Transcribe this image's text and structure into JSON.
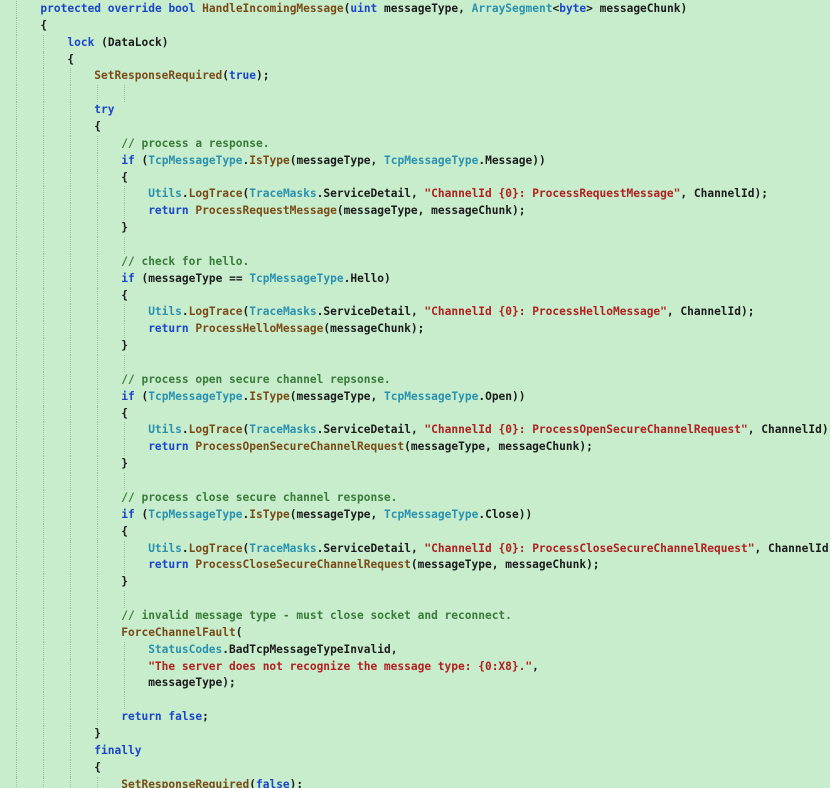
{
  "editor": {
    "background": "#c7edcc",
    "colors": {
      "keyword": "#1b46c9",
      "type": "#2b91af",
      "string": "#b12020",
      "comment": "#3a7a3a",
      "method": "#7a4a16",
      "text": "#1b1b1b"
    },
    "lines": [
      [
        [
          "ws",
          "      "
        ],
        [
          "kw",
          "protected"
        ],
        [
          "ws",
          " "
        ],
        [
          "kw",
          "override"
        ],
        [
          "ws",
          " "
        ],
        [
          "kw",
          "bool"
        ],
        [
          "ws",
          " "
        ],
        [
          "mth",
          "HandleIncomingMessage"
        ],
        [
          "punc",
          "("
        ],
        [
          "kw",
          "uint"
        ],
        [
          "ws",
          " "
        ],
        [
          "ident",
          "messageType"
        ],
        [
          "punc",
          ", "
        ],
        [
          "cls",
          "ArraySegment"
        ],
        [
          "punc",
          "<"
        ],
        [
          "kw",
          "byte"
        ],
        [
          "punc",
          "> "
        ],
        [
          "ident",
          "messageChunk"
        ],
        [
          "punc",
          ")"
        ]
      ],
      [
        [
          "ws",
          "      "
        ],
        [
          "punc",
          "{"
        ]
      ],
      [
        [
          "ws",
          "          "
        ],
        [
          "kw",
          "lock"
        ],
        [
          "ws",
          " "
        ],
        [
          "punc",
          "("
        ],
        [
          "ident",
          "DataLock"
        ],
        [
          "punc",
          ")"
        ]
      ],
      [
        [
          "ws",
          "          "
        ],
        [
          "punc",
          "{"
        ]
      ],
      [
        [
          "ws",
          "              "
        ],
        [
          "mth",
          "SetResponseRequired"
        ],
        [
          "punc",
          "("
        ],
        [
          "kw",
          "true"
        ],
        [
          "punc",
          ");"
        ]
      ],
      [],
      [
        [
          "ws",
          "              "
        ],
        [
          "kw",
          "try"
        ]
      ],
      [
        [
          "ws",
          "              "
        ],
        [
          "punc",
          "{"
        ]
      ],
      [
        [
          "ws",
          "                  "
        ],
        [
          "cmt",
          "// process a response."
        ]
      ],
      [
        [
          "ws",
          "                  "
        ],
        [
          "kw",
          "if"
        ],
        [
          "ws",
          " "
        ],
        [
          "punc",
          "("
        ],
        [
          "cls",
          "TcpMessageType"
        ],
        [
          "punc",
          "."
        ],
        [
          "mth",
          "IsType"
        ],
        [
          "punc",
          "("
        ],
        [
          "ident",
          "messageType"
        ],
        [
          "punc",
          ", "
        ],
        [
          "cls",
          "TcpMessageType"
        ],
        [
          "punc",
          "."
        ],
        [
          "prop",
          "Message"
        ],
        [
          "punc",
          "))"
        ]
      ],
      [
        [
          "ws",
          "                  "
        ],
        [
          "punc",
          "{"
        ]
      ],
      [
        [
          "ws",
          "                      "
        ],
        [
          "cls",
          "Utils"
        ],
        [
          "punc",
          "."
        ],
        [
          "mth",
          "LogTrace"
        ],
        [
          "punc",
          "("
        ],
        [
          "cls",
          "TraceMasks"
        ],
        [
          "punc",
          "."
        ],
        [
          "prop",
          "ServiceDetail"
        ],
        [
          "punc",
          ", "
        ],
        [
          "str",
          "\"ChannelId {0}: ProcessRequestMessage\""
        ],
        [
          "punc",
          ", "
        ],
        [
          "ident",
          "ChannelId"
        ],
        [
          "punc",
          ");"
        ]
      ],
      [
        [
          "ws",
          "                      "
        ],
        [
          "kw",
          "return"
        ],
        [
          "ws",
          " "
        ],
        [
          "mth",
          "ProcessRequestMessage"
        ],
        [
          "punc",
          "("
        ],
        [
          "ident",
          "messageType"
        ],
        [
          "punc",
          ", "
        ],
        [
          "ident",
          "messageChunk"
        ],
        [
          "punc",
          ");"
        ]
      ],
      [
        [
          "ws",
          "                  "
        ],
        [
          "punc",
          "}"
        ]
      ],
      [],
      [
        [
          "ws",
          "                  "
        ],
        [
          "cmt",
          "// check for hello."
        ]
      ],
      [
        [
          "ws",
          "                  "
        ],
        [
          "kw",
          "if"
        ],
        [
          "ws",
          " "
        ],
        [
          "punc",
          "("
        ],
        [
          "ident",
          "messageType"
        ],
        [
          "ws",
          " "
        ],
        [
          "punc",
          "=="
        ],
        [
          "ws",
          " "
        ],
        [
          "cls",
          "TcpMessageType"
        ],
        [
          "punc",
          "."
        ],
        [
          "prop",
          "Hello"
        ],
        [
          "punc",
          ")"
        ]
      ],
      [
        [
          "ws",
          "                  "
        ],
        [
          "punc",
          "{"
        ]
      ],
      [
        [
          "ws",
          "                      "
        ],
        [
          "cls",
          "Utils"
        ],
        [
          "punc",
          "."
        ],
        [
          "mth",
          "LogTrace"
        ],
        [
          "punc",
          "("
        ],
        [
          "cls",
          "TraceMasks"
        ],
        [
          "punc",
          "."
        ],
        [
          "prop",
          "ServiceDetail"
        ],
        [
          "punc",
          ", "
        ],
        [
          "str",
          "\"ChannelId {0}: ProcessHelloMessage\""
        ],
        [
          "punc",
          ", "
        ],
        [
          "ident",
          "ChannelId"
        ],
        [
          "punc",
          ");"
        ]
      ],
      [
        [
          "ws",
          "                      "
        ],
        [
          "kw",
          "return"
        ],
        [
          "ws",
          " "
        ],
        [
          "mth",
          "ProcessHelloMessage"
        ],
        [
          "punc",
          "("
        ],
        [
          "ident",
          "messageChunk"
        ],
        [
          "punc",
          ");"
        ]
      ],
      [
        [
          "ws",
          "                  "
        ],
        [
          "punc",
          "}"
        ]
      ],
      [],
      [
        [
          "ws",
          "                  "
        ],
        [
          "cmt",
          "// process open secure channel repsonse."
        ]
      ],
      [
        [
          "ws",
          "                  "
        ],
        [
          "kw",
          "if"
        ],
        [
          "ws",
          " "
        ],
        [
          "punc",
          "("
        ],
        [
          "cls",
          "TcpMessageType"
        ],
        [
          "punc",
          "."
        ],
        [
          "mth",
          "IsType"
        ],
        [
          "punc",
          "("
        ],
        [
          "ident",
          "messageType"
        ],
        [
          "punc",
          ", "
        ],
        [
          "cls",
          "TcpMessageType"
        ],
        [
          "punc",
          "."
        ],
        [
          "prop",
          "Open"
        ],
        [
          "punc",
          "))"
        ]
      ],
      [
        [
          "ws",
          "                  "
        ],
        [
          "punc",
          "{"
        ]
      ],
      [
        [
          "ws",
          "                      "
        ],
        [
          "cls",
          "Utils"
        ],
        [
          "punc",
          "."
        ],
        [
          "mth",
          "LogTrace"
        ],
        [
          "punc",
          "("
        ],
        [
          "cls",
          "TraceMasks"
        ],
        [
          "punc",
          "."
        ],
        [
          "prop",
          "ServiceDetail"
        ],
        [
          "punc",
          ", "
        ],
        [
          "str",
          "\"ChannelId {0}: ProcessOpenSecureChannelRequest\""
        ],
        [
          "punc",
          ", "
        ],
        [
          "ident",
          "ChannelId"
        ],
        [
          "punc",
          ");"
        ]
      ],
      [
        [
          "ws",
          "                      "
        ],
        [
          "kw",
          "return"
        ],
        [
          "ws",
          " "
        ],
        [
          "mth",
          "ProcessOpenSecureChannelRequest"
        ],
        [
          "punc",
          "("
        ],
        [
          "ident",
          "messageType"
        ],
        [
          "punc",
          ", "
        ],
        [
          "ident",
          "messageChunk"
        ],
        [
          "punc",
          ");"
        ]
      ],
      [
        [
          "ws",
          "                  "
        ],
        [
          "punc",
          "}"
        ]
      ],
      [],
      [
        [
          "ws",
          "                  "
        ],
        [
          "cmt",
          "// process close secure channel response."
        ]
      ],
      [
        [
          "ws",
          "                  "
        ],
        [
          "kw",
          "if"
        ],
        [
          "ws",
          " "
        ],
        [
          "punc",
          "("
        ],
        [
          "cls",
          "TcpMessageType"
        ],
        [
          "punc",
          "."
        ],
        [
          "mth",
          "IsType"
        ],
        [
          "punc",
          "("
        ],
        [
          "ident",
          "messageType"
        ],
        [
          "punc",
          ", "
        ],
        [
          "cls",
          "TcpMessageType"
        ],
        [
          "punc",
          "."
        ],
        [
          "prop",
          "Close"
        ],
        [
          "punc",
          "))"
        ]
      ],
      [
        [
          "ws",
          "                  "
        ],
        [
          "punc",
          "{"
        ]
      ],
      [
        [
          "ws",
          "                      "
        ],
        [
          "cls",
          "Utils"
        ],
        [
          "punc",
          "."
        ],
        [
          "mth",
          "LogTrace"
        ],
        [
          "punc",
          "("
        ],
        [
          "cls",
          "TraceMasks"
        ],
        [
          "punc",
          "."
        ],
        [
          "prop",
          "ServiceDetail"
        ],
        [
          "punc",
          ", "
        ],
        [
          "str",
          "\"ChannelId {0}: ProcessCloseSecureChannelRequest\""
        ],
        [
          "punc",
          ", "
        ],
        [
          "ident",
          "ChannelId"
        ],
        [
          "punc",
          ");"
        ]
      ],
      [
        [
          "ws",
          "                      "
        ],
        [
          "kw",
          "return"
        ],
        [
          "ws",
          " "
        ],
        [
          "mth",
          "ProcessCloseSecureChannelRequest"
        ],
        [
          "punc",
          "("
        ],
        [
          "ident",
          "messageType"
        ],
        [
          "punc",
          ", "
        ],
        [
          "ident",
          "messageChunk"
        ],
        [
          "punc",
          ");"
        ]
      ],
      [
        [
          "ws",
          "                  "
        ],
        [
          "punc",
          "}"
        ]
      ],
      [],
      [
        [
          "ws",
          "                  "
        ],
        [
          "cmt",
          "// invalid message type - must close socket and reconnect."
        ]
      ],
      [
        [
          "ws",
          "                  "
        ],
        [
          "mth",
          "ForceChannelFault"
        ],
        [
          "punc",
          "("
        ]
      ],
      [
        [
          "ws",
          "                      "
        ],
        [
          "cls",
          "StatusCodes"
        ],
        [
          "punc",
          "."
        ],
        [
          "prop",
          "BadTcpMessageTypeInvalid"
        ],
        [
          "punc",
          ","
        ]
      ],
      [
        [
          "ws",
          "                      "
        ],
        [
          "str",
          "\"The server does not recognize the message type: {0:X8}.\""
        ],
        [
          "punc",
          ","
        ]
      ],
      [
        [
          "ws",
          "                      "
        ],
        [
          "ident",
          "messageType"
        ],
        [
          "punc",
          ");"
        ]
      ],
      [],
      [
        [
          "ws",
          "                  "
        ],
        [
          "kw",
          "return"
        ],
        [
          "ws",
          " "
        ],
        [
          "kw",
          "false"
        ],
        [
          "punc",
          ";"
        ]
      ],
      [
        [
          "ws",
          "              "
        ],
        [
          "punc",
          "}"
        ]
      ],
      [
        [
          "ws",
          "              "
        ],
        [
          "kw",
          "finally"
        ]
      ],
      [
        [
          "ws",
          "              "
        ],
        [
          "punc",
          "{"
        ]
      ],
      [
        [
          "ws",
          "                  "
        ],
        [
          "mth",
          "SetResponseRequired"
        ],
        [
          "punc",
          "("
        ],
        [
          "kw",
          "false"
        ],
        [
          "punc",
          ");"
        ]
      ]
    ]
  }
}
